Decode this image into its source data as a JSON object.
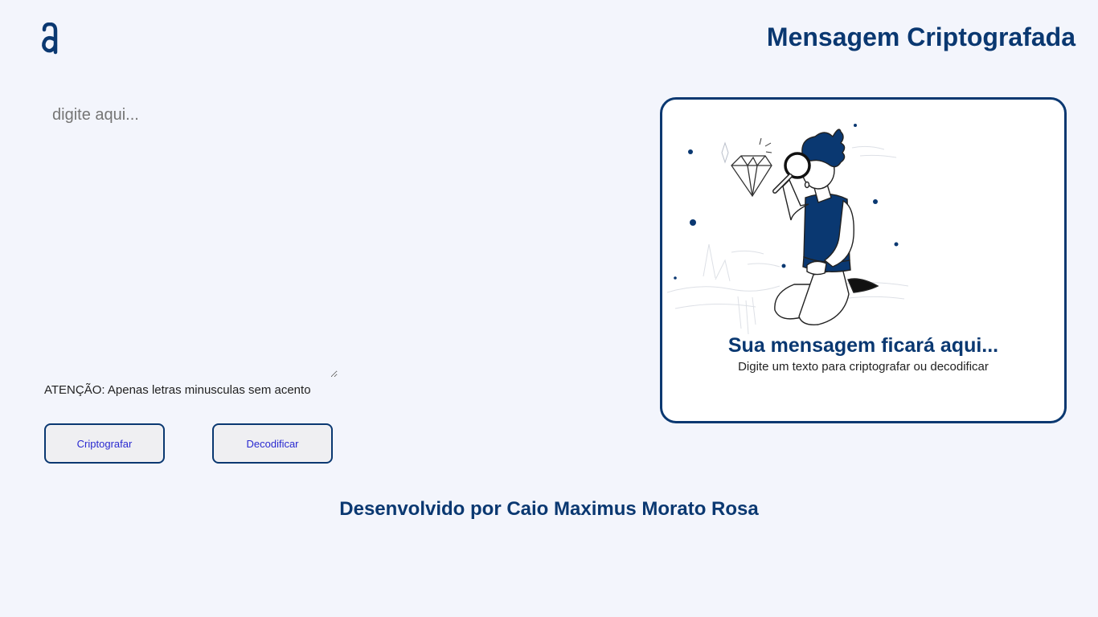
{
  "header": {
    "logo_icon": "alura-logo-icon",
    "title": "Mensagem Criptografada"
  },
  "input": {
    "placeholder": "digite aqui...",
    "value": ""
  },
  "warning": "ATENÇÃO: Apenas letras minusculas sem acento",
  "buttons": {
    "encrypt_label": "Criptografar",
    "decrypt_label": "Decodificar"
  },
  "output": {
    "illustration": "person-with-magnifier-illustration",
    "title": "Sua mensagem ficará aqui...",
    "subtitle": "Digite um texto para criptografar ou decodificar"
  },
  "footer": "Desenvolvido por Caio Maximus Morato Rosa",
  "colors": {
    "primary": "#0a3871",
    "background": "#f3f5fc",
    "button_text": "#2a2ad0"
  }
}
